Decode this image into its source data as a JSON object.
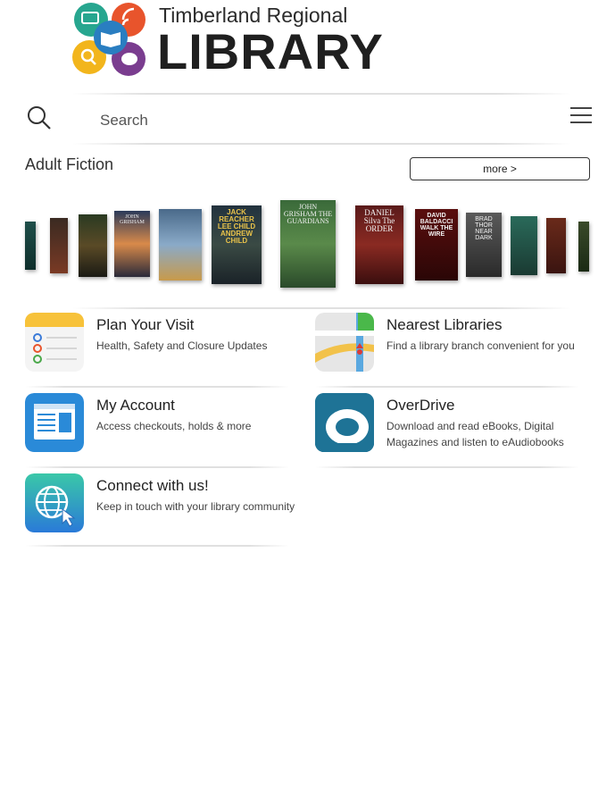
{
  "header": {
    "logo_line1": "Timberland Regional",
    "logo_line2": "LIBRARY"
  },
  "search": {
    "placeholder": "Search"
  },
  "section": {
    "title": "Adult Fiction",
    "more_label": "more >"
  },
  "books": [
    {
      "text": ""
    },
    {
      "text": ""
    },
    {
      "text": ""
    },
    {
      "text": "JOHN GRISHAM"
    },
    {
      "text": ""
    },
    {
      "text": "JACK REACHER LEE CHILD ANDREW CHILD"
    },
    {
      "text": "JOHN GRISHAM THE GUARDIANS"
    },
    {
      "text": "DANIEL Silva The ORDER"
    },
    {
      "text": "DAVID BALDACCI WALK THE WIRE"
    },
    {
      "text": "BRAD THOR NEAR DARK"
    },
    {
      "text": ""
    },
    {
      "text": ""
    },
    {
      "text": ""
    }
  ],
  "tiles": [
    {
      "title": "Plan Your Visit",
      "subtitle": "Health, Safety and Closure Updates",
      "icon": "notes-icon"
    },
    {
      "title": "Nearest Libraries",
      "subtitle": "Find a library branch convenient for you",
      "icon": "map-icon"
    },
    {
      "title": "My Account",
      "subtitle": "Access checkouts, holds & more",
      "icon": "account-icon"
    },
    {
      "title": "OverDrive",
      "subtitle": "Download and read eBooks, Digital Magazines and listen to eAudiobooks",
      "icon": "overdrive-icon"
    },
    {
      "title": "Connect with us!",
      "subtitle": "Keep in touch with your library community",
      "icon": "globe-icon"
    }
  ]
}
